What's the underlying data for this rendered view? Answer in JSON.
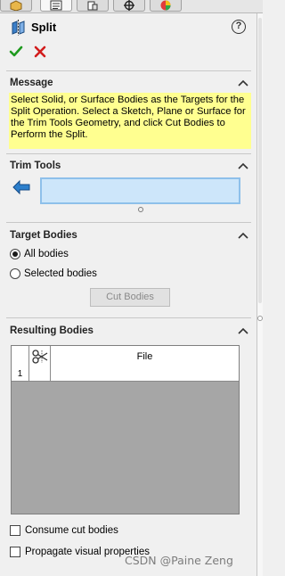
{
  "tabs": [
    {
      "icon": "feature-manager-icon",
      "active": false
    },
    {
      "icon": "property-manager-icon",
      "active": true
    },
    {
      "icon": "configuration-manager-icon",
      "active": false
    },
    {
      "icon": "dimxpert-icon",
      "active": false
    },
    {
      "icon": "display-manager-icon",
      "active": false
    }
  ],
  "header": {
    "title": "Split",
    "help_icon": "?"
  },
  "actions": {
    "ok_color": "#1e9a1e",
    "cancel_color": "#d21c1c"
  },
  "message": {
    "heading": "Message",
    "text": "Select Solid, or Surface Bodies as the Targets for the Split Operation. Select a Sketch, Plane or Surface for the Trim Tools Geometry, and click Cut Bodies to Perform the Split.",
    "background": "#ffff90"
  },
  "trim_tools": {
    "heading": "Trim Tools",
    "selection_value": ""
  },
  "target_bodies": {
    "heading": "Target Bodies",
    "options": [
      {
        "label": "All bodies",
        "checked": true
      },
      {
        "label": "Selected bodies",
        "checked": false
      }
    ],
    "cut_button": "Cut Bodies"
  },
  "resulting_bodies": {
    "heading": "Resulting Bodies",
    "columns": [
      "",
      "",
      "File"
    ],
    "rows": [
      {
        "num": "1",
        "file": ""
      }
    ]
  },
  "options": {
    "consume": {
      "label": "Consume cut bodies",
      "checked": false
    },
    "propagate": {
      "label": "Propagate visual properties",
      "checked": false
    }
  },
  "watermark": "CSDN @Paine Zeng"
}
